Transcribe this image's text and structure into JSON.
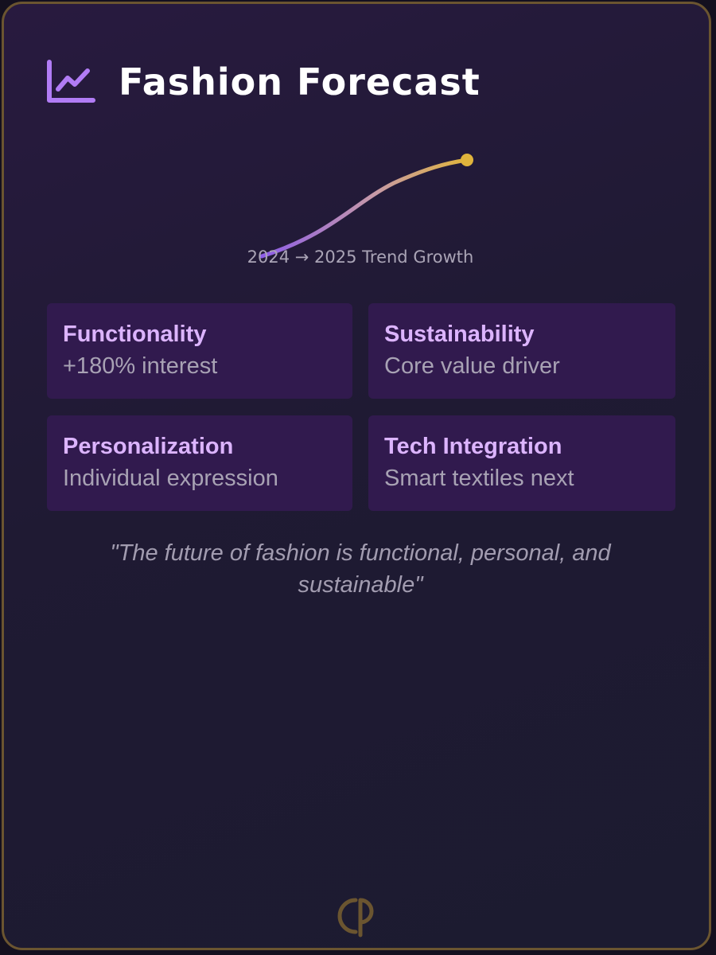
{
  "header": {
    "icon": "line-chart-icon",
    "title": "Fashion Forecast"
  },
  "trend": {
    "caption": "2024 → 2025 Trend Growth",
    "colors": {
      "start": "#8c5ce8",
      "end": "#e0b43c"
    }
  },
  "tiles": [
    {
      "title": "Functionality",
      "subtitle": "+180% interest"
    },
    {
      "title": "Sustainability",
      "subtitle": "Core value driver"
    },
    {
      "title": "Personalization",
      "subtitle": "Individual expression"
    },
    {
      "title": "Tech Integration",
      "subtitle": "Smart textiles next"
    }
  ],
  "quote": "\"The future of fashion is functional, personal, and sustainable\"",
  "footer": {
    "logo": "brand-monogram-logo",
    "logo_color": "#6b5530"
  }
}
